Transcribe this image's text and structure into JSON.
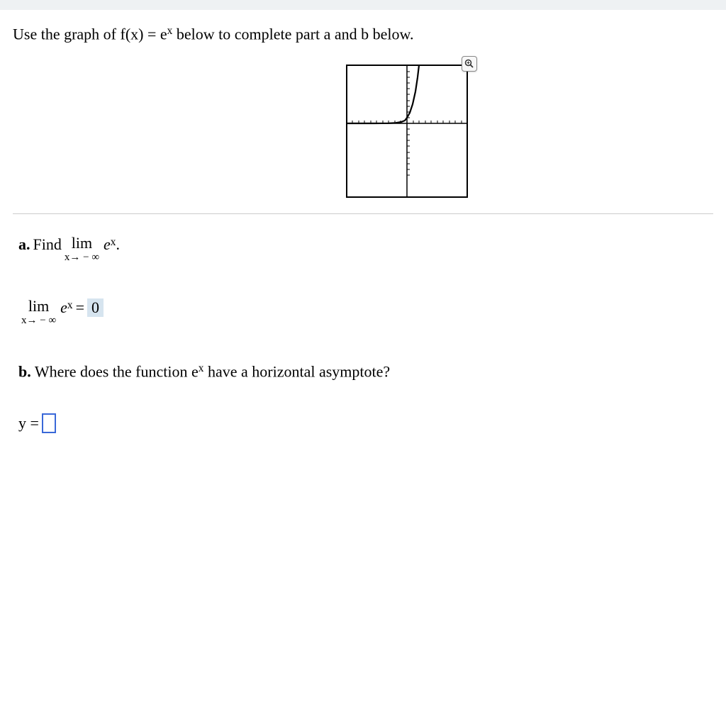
{
  "instruction": {
    "prefix": "Use the graph of f(x) = e",
    "exp": "x",
    "suffix": " below to complete part a and b below."
  },
  "partA": {
    "label": "a.",
    "text1": "Find",
    "lim": "lim",
    "approach": "x→ − ∞",
    "func_base": "e",
    "func_exp": "x",
    "period": ".",
    "answer_eq": "=",
    "answer_val": "0"
  },
  "partB": {
    "label": "b.",
    "text_prefix": "Where does the function e",
    "exp": "x",
    "text_suffix": " have a horizontal asymptote?",
    "y_label": "y =",
    "y_value": ""
  },
  "chart_data": {
    "type": "line",
    "title": "",
    "xlabel": "",
    "ylabel": "",
    "xlim": [
      -10,
      10
    ],
    "ylim": [
      -10,
      10
    ],
    "series": [
      {
        "name": "e^x",
        "x": [
          -10,
          -8,
          -6,
          -4,
          -2,
          -1,
          0,
          1,
          2
        ],
        "values": [
          5e-05,
          0.0003,
          0.0025,
          0.018,
          0.135,
          0.368,
          1,
          2.718,
          7.389
        ]
      }
    ]
  }
}
